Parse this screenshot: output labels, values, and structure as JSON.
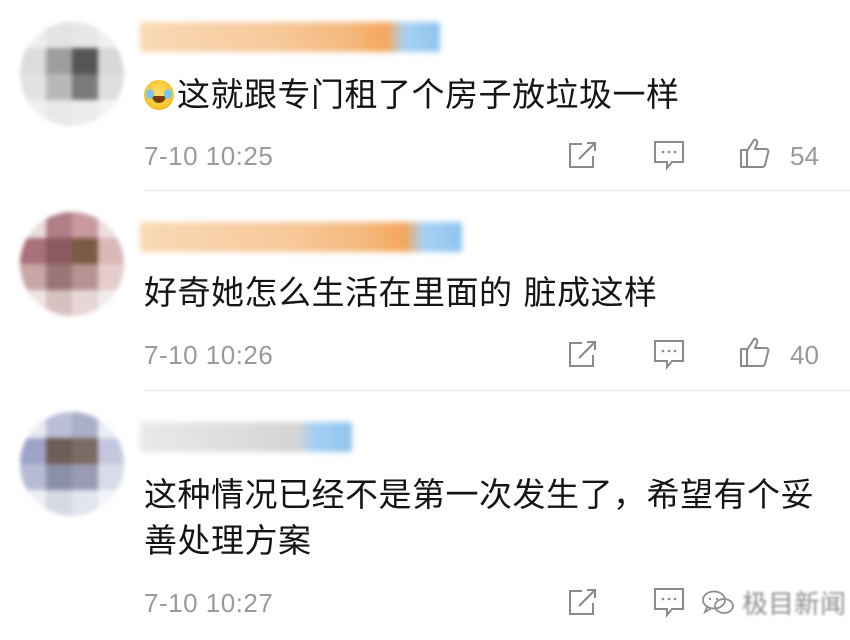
{
  "comments": [
    {
      "text": "这就跟专门租了个房子放垃圾一样",
      "has_emoji": true,
      "emoji_icon": "laughing-tears-emoji",
      "time": "7-10 10:25",
      "likes": "54"
    },
    {
      "text": "好奇她怎么生活在里面的 脏成这样",
      "has_emoji": false,
      "time": "7-10 10:26",
      "likes": "40"
    },
    {
      "text": "这种情况已经不是第一次发生了，希望有个妥善处理方案",
      "has_emoji": false,
      "time": "7-10 10:27",
      "likes": ""
    }
  ],
  "icons": {
    "repost": "repost-icon",
    "reply": "comment-icon",
    "like": "thumbs-up-icon",
    "watermark": "wechat-icon"
  },
  "watermark": {
    "text": "极目新闻"
  },
  "colors": {
    "text": "#151515",
    "meta": "#9a9a9a",
    "divider": "#e8e8e8",
    "username_blur_orange": "#f7b877",
    "username_blur_blue": "#8ec3ee"
  }
}
